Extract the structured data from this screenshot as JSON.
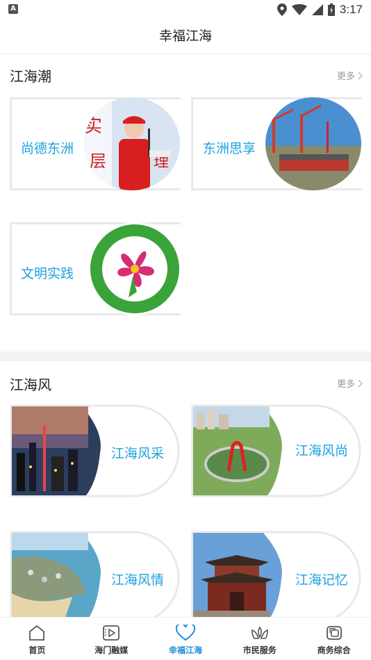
{
  "status_bar": {
    "time": "3:17",
    "left_icon": "A"
  },
  "header": {
    "title": "幸福江海"
  },
  "section1": {
    "title": "江海潮",
    "more": "更多",
    "cards": [
      {
        "label": "尚德东洲",
        "image": "volunteer-speaking-photo"
      },
      {
        "label": "东洲思享",
        "image": "shipyard-cranes-photo"
      },
      {
        "label": "文明实践",
        "image": "civilization-practice-logo"
      }
    ]
  },
  "section2": {
    "title": "江海风",
    "more": "更多",
    "cards": [
      {
        "label": "江海风采",
        "image": "city-night-skyline-photo"
      },
      {
        "label": "江海风尚",
        "image": "roundabout-monument-photo"
      },
      {
        "label": "江海风情",
        "image": "coastal-town-photo"
      },
      {
        "label": "江海记忆",
        "image": "traditional-gate-photo"
      }
    ]
  },
  "bottom_nav": {
    "items": [
      {
        "label": "首页",
        "icon": "home-icon"
      },
      {
        "label": "海门融媒",
        "icon": "media-play-icon"
      },
      {
        "label": "幸福江海",
        "icon": "heart-icon"
      },
      {
        "label": "市民服务",
        "icon": "leaf-hands-icon"
      },
      {
        "label": "商务综合",
        "icon": "layers-icon"
      }
    ],
    "active_index": 2,
    "active_color": "#1a8fd6",
    "label_accent": "#1da1e0"
  }
}
